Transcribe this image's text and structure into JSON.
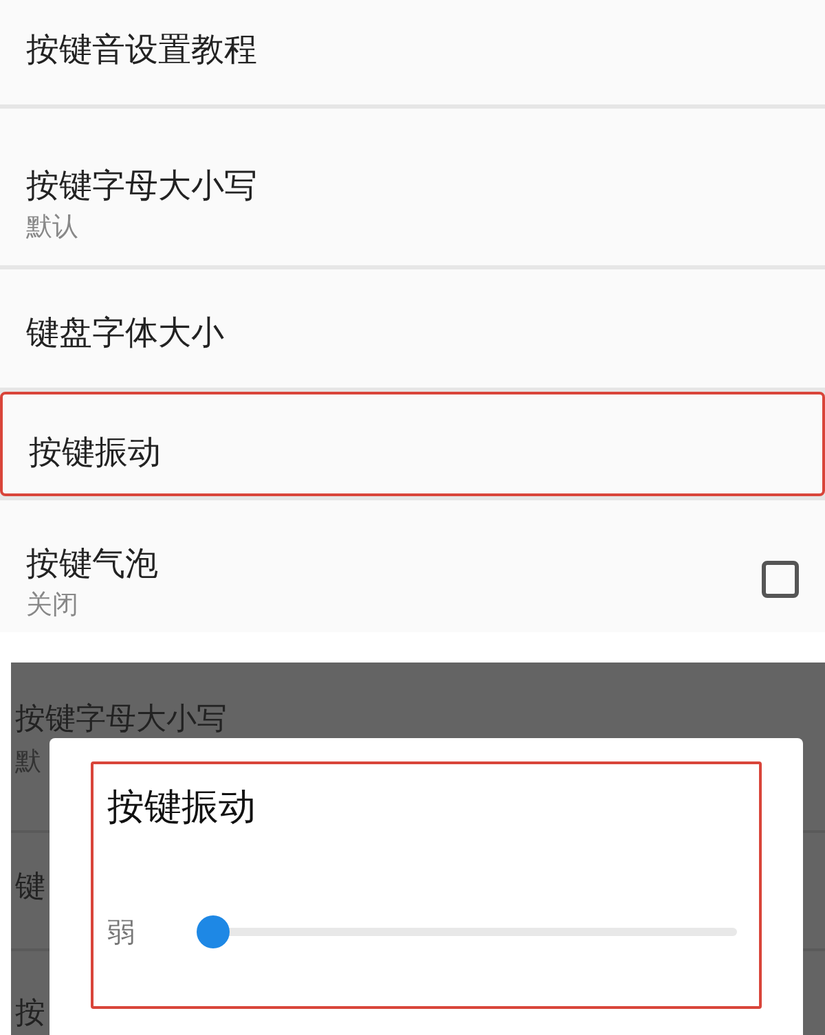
{
  "settings_list": {
    "items": [
      {
        "title": "按键音设置教程",
        "highlighted": false
      },
      {
        "title": "按键字母大小写",
        "value": "默认",
        "highlighted": false
      },
      {
        "title": "键盘字体大小",
        "highlighted": false
      },
      {
        "title": "按键振动",
        "highlighted": true
      },
      {
        "title": "按键气泡",
        "value": "关闭",
        "highlighted": false,
        "kind": "checkbox",
        "checked": false
      }
    ]
  },
  "background_list": {
    "items": [
      {
        "title": "按键字母大小写",
        "value": "默"
      },
      {
        "title": "键"
      },
      {
        "title": "按"
      }
    ]
  },
  "dialog": {
    "title": "按键振动",
    "highlighted": true,
    "slider": {
      "min_label": "弱",
      "level": 0
    }
  }
}
